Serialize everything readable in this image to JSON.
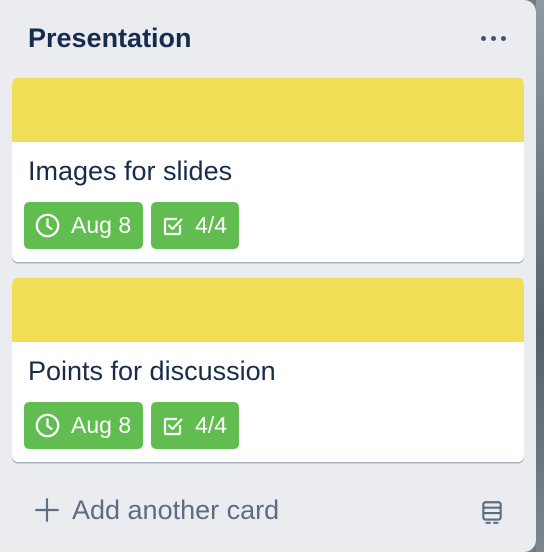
{
  "list": {
    "title": "Presentation",
    "menu_icon": "more-horizontal-icon",
    "cards": [
      {
        "title": "Images for slides",
        "cover_color": "#f2dd57",
        "due_date": "Aug 8",
        "checklist": "4/4",
        "badge_color": "#61bd4f"
      },
      {
        "title": "Points for discussion",
        "cover_color": "#f2dd57",
        "due_date": "Aug 8",
        "checklist": "4/4",
        "badge_color": "#61bd4f"
      }
    ],
    "add_card_label": "Add another card",
    "add_icon": "plus-icon",
    "template_icon": "card-template-icon"
  }
}
